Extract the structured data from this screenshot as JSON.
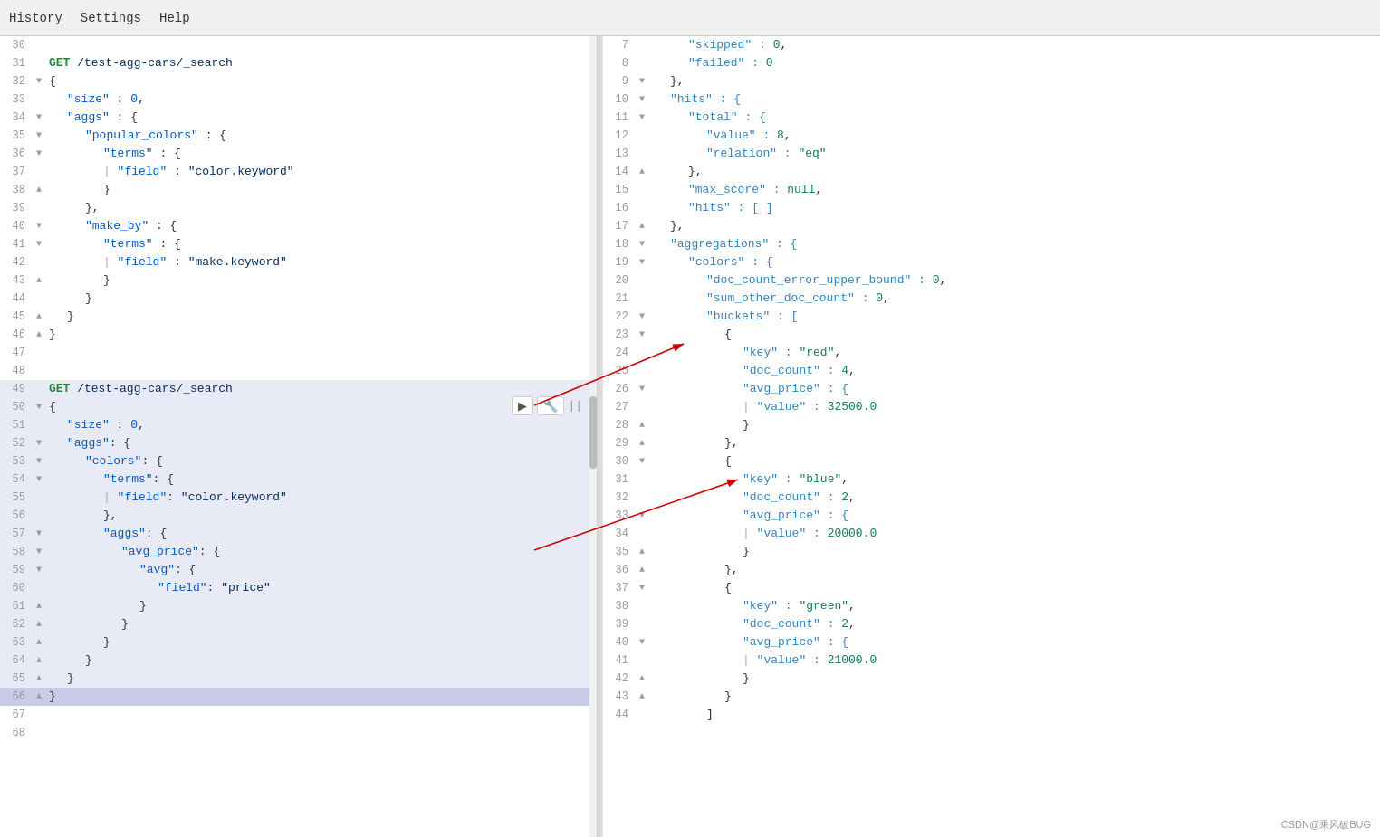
{
  "menu": {
    "items": [
      "History",
      "Settings",
      "Help"
    ]
  },
  "left_panel": {
    "lines": [
      {
        "num": 30,
        "fold": "",
        "content": "",
        "class": ""
      },
      {
        "num": 31,
        "fold": "",
        "content": "GET /test-agg-cars/_search",
        "class": "method-path"
      },
      {
        "num": 32,
        "fold": "▼",
        "content": "{",
        "class": ""
      },
      {
        "num": 33,
        "fold": "",
        "content": "    \"size\" : 0,",
        "class": ""
      },
      {
        "num": 34,
        "fold": "▼",
        "content": "    \"aggs\" : {",
        "class": ""
      },
      {
        "num": 35,
        "fold": "▼",
        "content": "        \"popular_colors\" : {",
        "class": ""
      },
      {
        "num": 36,
        "fold": "▼",
        "content": "            \"terms\" : {",
        "class": ""
      },
      {
        "num": 37,
        "fold": "",
        "content": "            |   \"field\" : \"color.keyword\"",
        "class": ""
      },
      {
        "num": 38,
        "fold": "▲",
        "content": "            }",
        "class": ""
      },
      {
        "num": 39,
        "fold": "",
        "content": "        },",
        "class": ""
      },
      {
        "num": 40,
        "fold": "▼",
        "content": "        \"make_by\" : {",
        "class": ""
      },
      {
        "num": 41,
        "fold": "▼",
        "content": "            \"terms\" : {",
        "class": ""
      },
      {
        "num": 42,
        "fold": "",
        "content": "            |   \"field\" : \"make.keyword\"",
        "class": ""
      },
      {
        "num": 43,
        "fold": "▲",
        "content": "            }",
        "class": ""
      },
      {
        "num": 44,
        "fold": "",
        "content": "        }",
        "class": ""
      },
      {
        "num": 45,
        "fold": "▲",
        "content": "    }",
        "class": ""
      },
      {
        "num": 46,
        "fold": "▲",
        "content": "}",
        "class": ""
      },
      {
        "num": 47,
        "fold": "",
        "content": "",
        "class": ""
      },
      {
        "num": 48,
        "fold": "",
        "content": "",
        "class": ""
      },
      {
        "num": 49,
        "fold": "",
        "content": "GET /test-agg-cars/_search",
        "class": "method-path selected"
      },
      {
        "num": 50,
        "fold": "▼",
        "content": "{",
        "class": "selected"
      },
      {
        "num": 51,
        "fold": "",
        "content": "    \"size\" : 0,",
        "class": "selected"
      },
      {
        "num": 52,
        "fold": "▼",
        "content": "    \"aggs\": {",
        "class": "selected"
      },
      {
        "num": 53,
        "fold": "▼",
        "content": "        \"colors\": {",
        "class": "selected"
      },
      {
        "num": 54,
        "fold": "▼",
        "content": "            \"terms\": {",
        "class": "selected"
      },
      {
        "num": 55,
        "fold": "",
        "content": "            |   \"field\": \"color.keyword\"",
        "class": "selected"
      },
      {
        "num": 56,
        "fold": "",
        "content": "            },",
        "class": "selected"
      },
      {
        "num": 57,
        "fold": "▼",
        "content": "            \"aggs\": {",
        "class": "selected"
      },
      {
        "num": 58,
        "fold": "▼",
        "content": "                \"avg_price\": {",
        "class": "selected"
      },
      {
        "num": 59,
        "fold": "▼",
        "content": "                    \"avg\": {",
        "class": "selected"
      },
      {
        "num": 60,
        "fold": "",
        "content": "                        \"field\": \"price\"",
        "class": "selected"
      },
      {
        "num": 61,
        "fold": "▲",
        "content": "                    }",
        "class": "selected"
      },
      {
        "num": 62,
        "fold": "▲",
        "content": "                }",
        "class": "selected"
      },
      {
        "num": 63,
        "fold": "▲",
        "content": "            }",
        "class": "selected"
      },
      {
        "num": 64,
        "fold": "▲",
        "content": "        }",
        "class": "selected"
      },
      {
        "num": 65,
        "fold": "▲",
        "content": "    }",
        "class": "selected"
      },
      {
        "num": 66,
        "fold": "▲",
        "content": "}",
        "class": "selected-last"
      },
      {
        "num": 67,
        "fold": "",
        "content": "",
        "class": ""
      },
      {
        "num": 68,
        "fold": "",
        "content": "",
        "class": ""
      }
    ]
  },
  "right_panel": {
    "lines": [
      {
        "num": 7,
        "fold": "",
        "content": "        \"skipped\" : 0,"
      },
      {
        "num": 8,
        "fold": "",
        "content": "        \"failed\" : 0"
      },
      {
        "num": 9,
        "fold": "▼",
        "content": "    },"
      },
      {
        "num": 10,
        "fold": "▼",
        "content": "    \"hits\" : {"
      },
      {
        "num": 11,
        "fold": "▼",
        "content": "        \"total\" : {"
      },
      {
        "num": 12,
        "fold": "",
        "content": "            \"value\" : 8,"
      },
      {
        "num": 13,
        "fold": "",
        "content": "            \"relation\" : \"eq\""
      },
      {
        "num": 14,
        "fold": "▲",
        "content": "        },"
      },
      {
        "num": 15,
        "fold": "",
        "content": "        \"max_score\" : null,"
      },
      {
        "num": 16,
        "fold": "",
        "content": "        \"hits\" : [ ]"
      },
      {
        "num": 17,
        "fold": "▲",
        "content": "    },"
      },
      {
        "num": 18,
        "fold": "▼",
        "content": "    \"aggregations\" : {"
      },
      {
        "num": 19,
        "fold": "▼",
        "content": "        \"colors\" : {"
      },
      {
        "num": 20,
        "fold": "",
        "content": "            \"doc_count_error_upper_bound\" : 0,"
      },
      {
        "num": 21,
        "fold": "",
        "content": "            \"sum_other_doc_count\" : 0,"
      },
      {
        "num": 22,
        "fold": "▼",
        "content": "            \"buckets\" : ["
      },
      {
        "num": 23,
        "fold": "▼",
        "content": "                {"
      },
      {
        "num": 24,
        "fold": "",
        "content": "                    \"key\" : \"red\","
      },
      {
        "num": 25,
        "fold": "",
        "content": "                    \"doc_count\" : 4,"
      },
      {
        "num": 26,
        "fold": "▼",
        "content": "                    \"avg_price\" : {"
      },
      {
        "num": 27,
        "fold": "",
        "content": "                    |   \"value\" : 32500.0"
      },
      {
        "num": 28,
        "fold": "▲",
        "content": "                    }"
      },
      {
        "num": 29,
        "fold": "▲",
        "content": "                },"
      },
      {
        "num": 30,
        "fold": "▼",
        "content": "                {"
      },
      {
        "num": 31,
        "fold": "",
        "content": "                    \"key\" : \"blue\","
      },
      {
        "num": 32,
        "fold": "",
        "content": "                    \"doc_count\" : 2,"
      },
      {
        "num": 33,
        "fold": "▼",
        "content": "                    \"avg_price\" : {"
      },
      {
        "num": 34,
        "fold": "",
        "content": "                    |   \"value\" : 20000.0"
      },
      {
        "num": 35,
        "fold": "▲",
        "content": "                    }"
      },
      {
        "num": 36,
        "fold": "▲",
        "content": "                },"
      },
      {
        "num": 37,
        "fold": "▼",
        "content": "                {"
      },
      {
        "num": 38,
        "fold": "",
        "content": "                    \"key\" : \"green\","
      },
      {
        "num": 39,
        "fold": "",
        "content": "                    \"doc_count\" : 2,"
      },
      {
        "num": 40,
        "fold": "▼",
        "content": "                    \"avg_price\" : {"
      },
      {
        "num": 41,
        "fold": "",
        "content": "                    |   \"value\" : 21000.0"
      },
      {
        "num": 42,
        "fold": "▲",
        "content": "                    }"
      },
      {
        "num": 43,
        "fold": "▲",
        "content": "                }"
      },
      {
        "num": 44,
        "fold": "",
        "content": "            ]"
      }
    ]
  },
  "watermark": "CSDN@乘风破BUG"
}
